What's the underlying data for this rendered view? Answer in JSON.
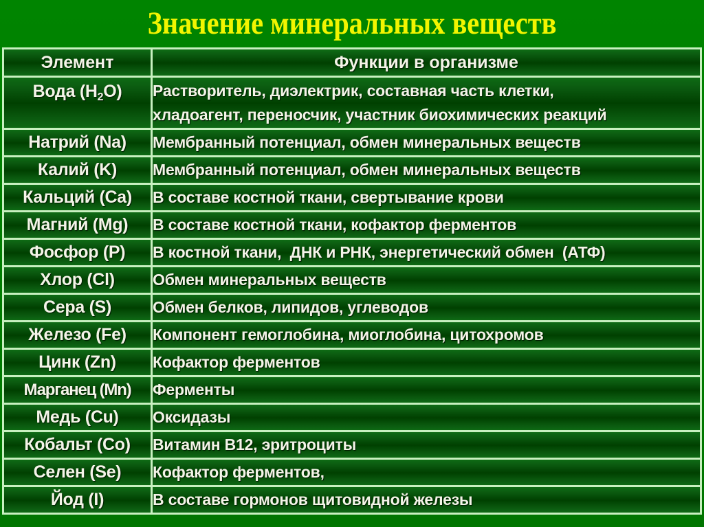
{
  "title": "Значение минеральных веществ",
  "table": {
    "headers": {
      "element": "Элемент",
      "functions": "Функции в организме"
    },
    "water": {
      "element_prefix": "Вода (H",
      "element_subscript": "2",
      "element_suffix": "O)",
      "functions_lines": [
        "Растворитель, диэлектрик, составная часть клетки,",
        "хладоагент, переносчик, участник биохимических реакций"
      ]
    },
    "rows": [
      {
        "element": "Натрий (Na)",
        "functions": "Мембранный потенциал, обмен минеральных веществ"
      },
      {
        "element": "Калий (K)",
        "functions": "Мембранный потенциал, обмен минеральных веществ"
      },
      {
        "element": "Кальций (Ca)",
        "functions": "В составе костной ткани, свертывание крови"
      },
      {
        "element": "Магний (Mg)",
        "functions": "В составе костной ткани, кофактор ферментов"
      },
      {
        "element": "Фосфор (P)",
        "functions": "В костной ткани,  ДНК и РНК, энергетический обмен  (АТФ)"
      },
      {
        "element": "Хлор (Cl)",
        "functions": "Обмен минеральных веществ"
      },
      {
        "element": "Сера (S)",
        "functions": "Обмен белков, липидов, углеводов"
      },
      {
        "element": "Железо (Fe)",
        "functions": "Компонент гемоглобина, миоглобина, цитохромов"
      },
      {
        "element": "Цинк (Zn)",
        "functions": "Кофактор ферментов"
      },
      {
        "element": "Марганец (Mn)",
        "functions": "Ферменты"
      },
      {
        "element": "Медь (Cu)",
        "functions": "Оксидазы"
      },
      {
        "element": "Кобальт (Co)",
        "functions": "Витамин В12, эритроциты"
      },
      {
        "element": "Селен (Se)",
        "functions": "Кофактор ферментов,"
      },
      {
        "element": "Йод (I)",
        "functions": "В составе гормонов щитовидной железы"
      }
    ]
  },
  "colors": {
    "background": "#007d00",
    "title": "#f2f500",
    "cell_text": "#f4f4e8",
    "grid": "#c8f0c0",
    "cell_dark": "#004000"
  }
}
